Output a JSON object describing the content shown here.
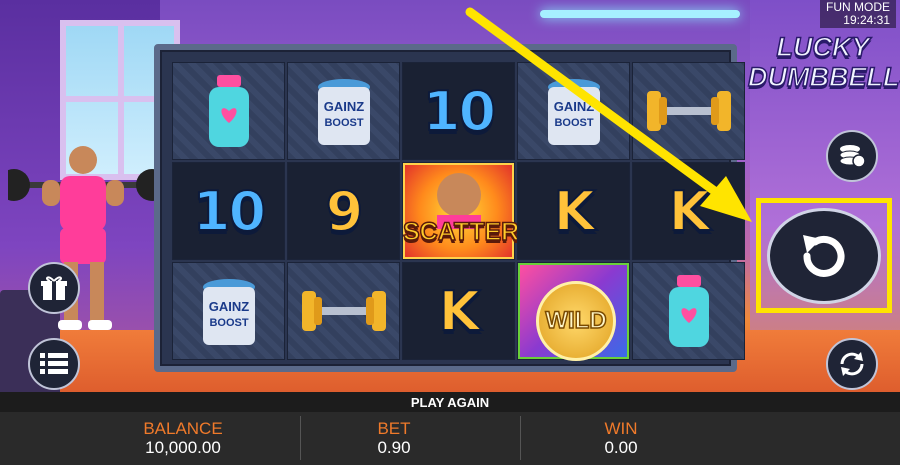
{
  "header": {
    "mode_label": "FUN MODE",
    "clock": "19:24:31",
    "logo_line1": "LUCKY",
    "logo_line2": "DUMBBELLS"
  },
  "reels": {
    "rows": [
      [
        "bottle",
        "gainz-boost-can",
        "10",
        "gainz-boost-can",
        "dumbbell"
      ],
      [
        "10",
        "9",
        "scatter",
        "K",
        "K"
      ],
      [
        "gainz-boost-can",
        "dumbbell",
        "K",
        "wild",
        "bottle"
      ]
    ],
    "symbol_text": {
      "ten": "10",
      "nine": "9",
      "king": "K",
      "scatter": "SCATTER",
      "wild": "WILD",
      "can_line1": "GAINZ",
      "can_line2": "BOOST"
    }
  },
  "side_buttons": [
    {
      "name": "coin-stack-icon"
    },
    {
      "name": "replay-icon",
      "highlighted": true
    },
    {
      "name": "autoplay-icon"
    }
  ],
  "left_buttons": [
    {
      "name": "gift-icon"
    },
    {
      "name": "menu-icon"
    }
  ],
  "play_bar": {
    "label": "PLAY AGAIN"
  },
  "stats": {
    "balance_label": "BALANCE",
    "balance_value": "10,000.00",
    "bet_label": "BET",
    "bet_value": "0.90",
    "win_label": "WIN",
    "win_value": "0.00"
  },
  "colors": {
    "accent": "#f07a2a",
    "highlight": "#ffe400",
    "annotation_arrow": "#ffe400"
  }
}
